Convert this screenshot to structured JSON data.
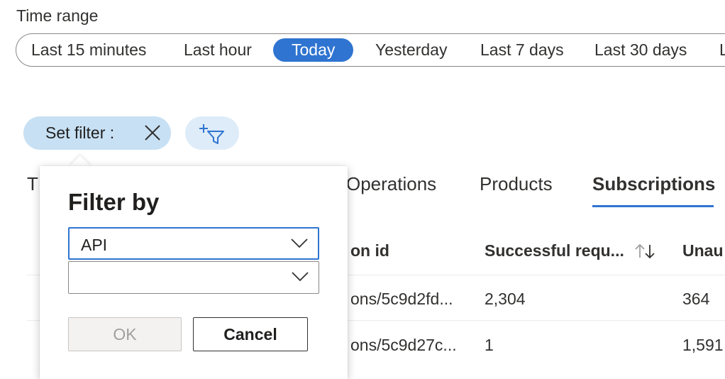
{
  "time_range": {
    "label": "Time range",
    "options": [
      "Last 15 minutes",
      "Last hour",
      "Today",
      "Yesterday",
      "Last 7 days",
      "Last 30 days",
      "L"
    ],
    "selected": "Today"
  },
  "filter_chip": {
    "label": "Set filter :"
  },
  "tabs": [
    "T",
    "Operations",
    "Products",
    "Subscriptions"
  ],
  "active_tab": "Subscriptions",
  "table": {
    "headers": [
      "on id",
      "Successful requ...",
      "Unau"
    ],
    "rows": [
      [
        "ons/5c9d2fd...",
        "2,304",
        "364"
      ],
      [
        "ons/5c9d27c...",
        "1",
        "1,591"
      ]
    ]
  },
  "filter_popup": {
    "title": "Filter by",
    "dropdown1_value": "API",
    "dropdown2_value": "",
    "ok_label": "OK",
    "cancel_label": "Cancel"
  },
  "colors": {
    "accent": "#2f74d0",
    "chip_bg": "#c7e0f4",
    "add_filter_bg": "#deecf9"
  },
  "icons": [
    "close-icon",
    "add-filter-icon",
    "sort-icon",
    "chevron-down-icon"
  ]
}
